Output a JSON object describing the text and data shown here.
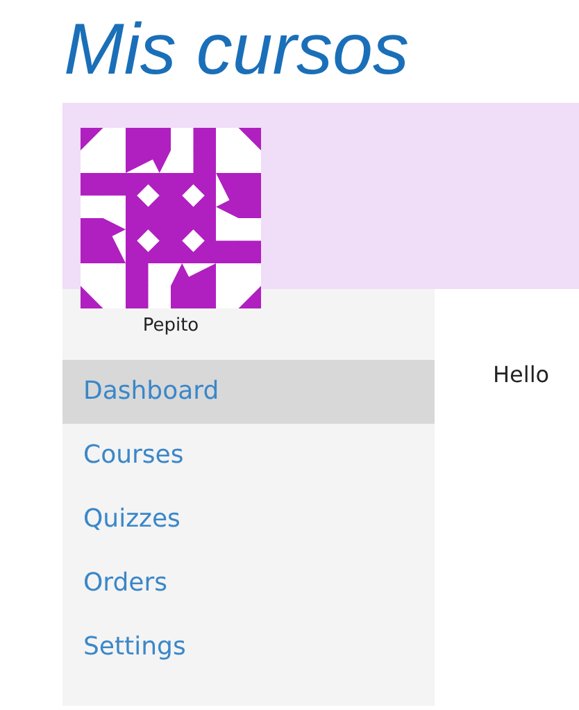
{
  "title": "Mis cursos",
  "user": {
    "name": "Pepito"
  },
  "menu": [
    {
      "label": "Dashboard",
      "selected": true
    },
    {
      "label": "Courses",
      "selected": false
    },
    {
      "label": "Quizzes",
      "selected": false
    },
    {
      "label": "Orders",
      "selected": false
    },
    {
      "label": "Settings",
      "selected": false
    }
  ],
  "content": {
    "greeting": "Hello"
  }
}
